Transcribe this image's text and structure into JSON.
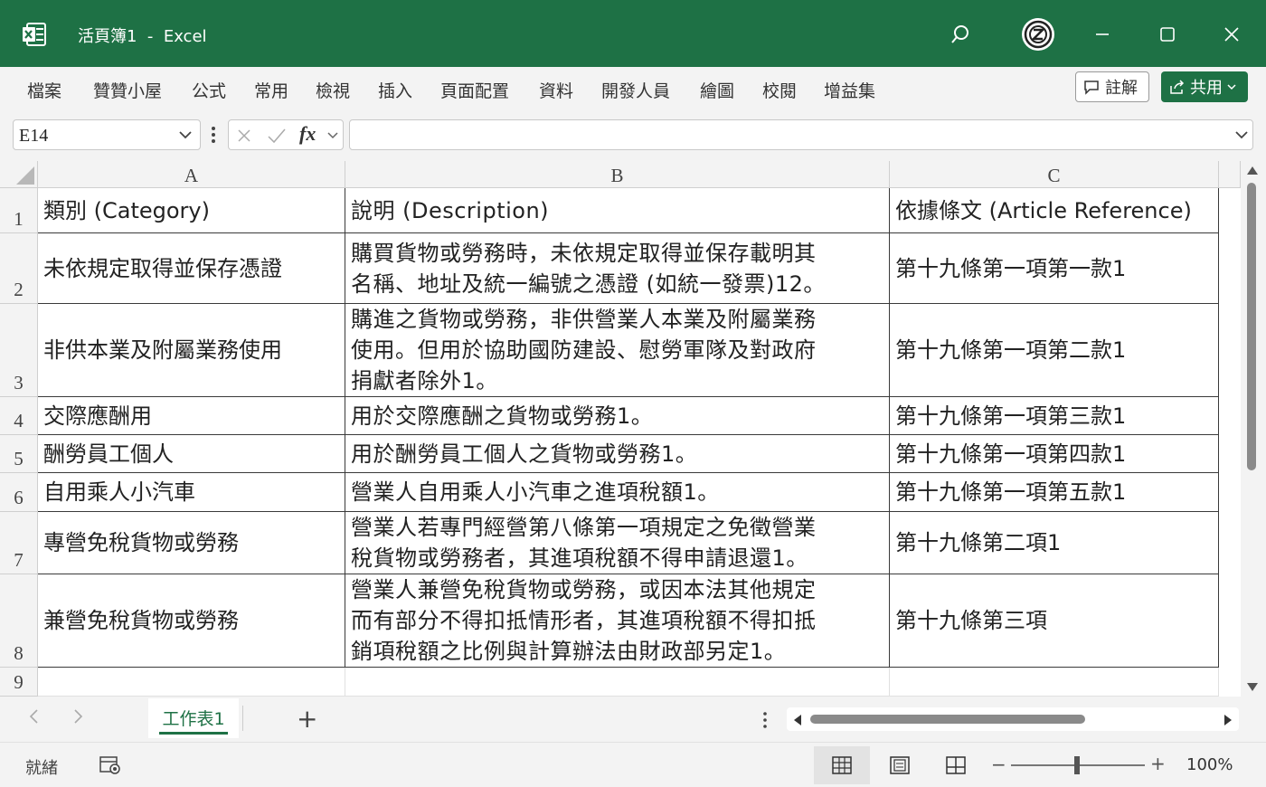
{
  "window": {
    "title": "活頁簿1  -  Excel"
  },
  "ribbon": {
    "tabs": [
      "檔案",
      "贊贊小屋",
      "公式",
      "常用",
      "檢視",
      "插入",
      "頁面配置",
      "資料",
      "開發人員",
      "繪圖",
      "校閱",
      "增益集"
    ],
    "comment_label": "註解",
    "share_label": "共用"
  },
  "formula_bar": {
    "name_box": "E14",
    "fx_label": "fx",
    "formula": ""
  },
  "columns": [
    "A",
    "B",
    "C"
  ],
  "rows": [
    {
      "num": "1",
      "a": "類別 (Category)",
      "b": [
        "說明 (Description)"
      ],
      "c": "依據條文 (Article Reference)"
    },
    {
      "num": "2",
      "a": "未依規定取得並保存憑證",
      "b": [
        "購買貨物或勞務時，未依規定取得並保存載明其",
        "名稱、地址及統一編號之憑證 (如統一發票)12。"
      ],
      "c": "第十九條第一項第一款1"
    },
    {
      "num": "3",
      "a": "非供本業及附屬業務使用",
      "b": [
        "購進之貨物或勞務，非供營業人本業及附屬業務",
        "使用。但用於協助國防建設、慰勞軍隊及對政府",
        "捐獻者除外1。"
      ],
      "c": "第十九條第一項第二款1"
    },
    {
      "num": "4",
      "a": "交際應酬用",
      "b": [
        "用於交際應酬之貨物或勞務1。"
      ],
      "c": "第十九條第一項第三款1"
    },
    {
      "num": "5",
      "a": "酬勞員工個人",
      "b": [
        "用於酬勞員工個人之貨物或勞務1。"
      ],
      "c": "第十九條第一項第四款1"
    },
    {
      "num": "6",
      "a": "自用乘人小汽車",
      "b": [
        "營業人自用乘人小汽車之進項稅額1。"
      ],
      "c": "第十九條第一項第五款1"
    },
    {
      "num": "7",
      "a": "專營免稅貨物或勞務",
      "b": [
        "營業人若專門經營第八條第一項規定之免徵營業",
        "稅貨物或勞務者，其進項稅額不得申請退還1。"
      ],
      "c": "第十九條第二項1"
    },
    {
      "num": "8",
      "a": "兼營免稅貨物或勞務",
      "b": [
        "營業人兼營免稅貨物或勞務，或因本法其他規定",
        "而有部分不得扣抵情形者，其進項稅額不得扣抵",
        "銷項稅額之比例與計算辦法由財政部另定1。"
      ],
      "c": "第十九條第三項"
    },
    {
      "num": "9",
      "a": "",
      "b": [
        ""
      ],
      "c": ""
    }
  ],
  "sheets": {
    "tabs": [
      "工作表1"
    ],
    "add_label": "+"
  },
  "status": {
    "text": "就緒",
    "zoom": "100%",
    "zoom_minus": "−",
    "zoom_plus": "+"
  },
  "colors": {
    "accent": "#1e7145",
    "chrome": "#f3f3f3",
    "grid_border": "#3a3a3a"
  }
}
